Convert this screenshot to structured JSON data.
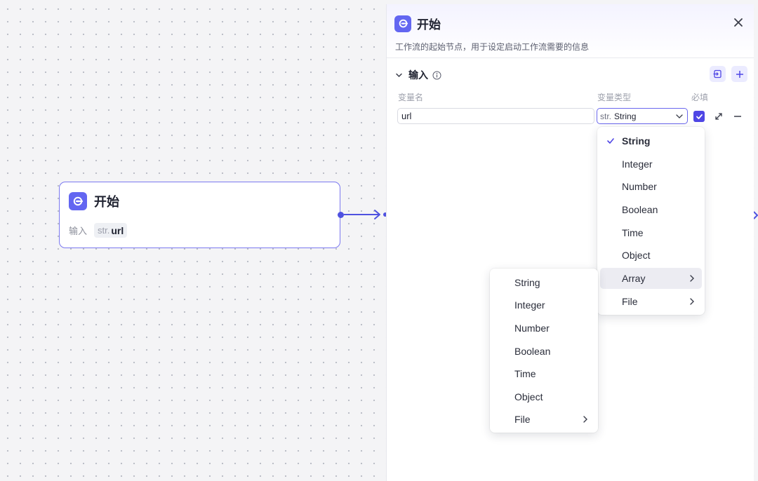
{
  "node": {
    "title": "开始",
    "input_label": "输入",
    "var_type": "str.",
    "var_name": "url"
  },
  "panel": {
    "title": "开始",
    "description": "工作流的起始节点，用于设定启动工作流需要的信息",
    "section_title": "输入",
    "columns": {
      "name": "变量名",
      "type": "变量类型",
      "required": "必填"
    },
    "variable": {
      "name": "url",
      "type_prefix": "str.",
      "type": "String",
      "required": true
    }
  },
  "type_menu": {
    "items": [
      {
        "label": "String",
        "selected": true
      },
      {
        "label": "Integer"
      },
      {
        "label": "Number"
      },
      {
        "label": "Boolean"
      },
      {
        "label": "Time"
      },
      {
        "label": "Object"
      },
      {
        "label": "Array",
        "has_submenu": true,
        "hovered": true
      },
      {
        "label": "File",
        "has_submenu": true
      }
    ]
  },
  "array_submenu": {
    "items": [
      {
        "label": "String"
      },
      {
        "label": "Integer"
      },
      {
        "label": "Number"
      },
      {
        "label": "Boolean"
      },
      {
        "label": "Time"
      },
      {
        "label": "Object"
      },
      {
        "label": "File",
        "has_submenu": true
      }
    ]
  },
  "colors": {
    "accent": "#6366f1",
    "selection_border": "#7b78f0",
    "edge": "#4f52e0"
  }
}
